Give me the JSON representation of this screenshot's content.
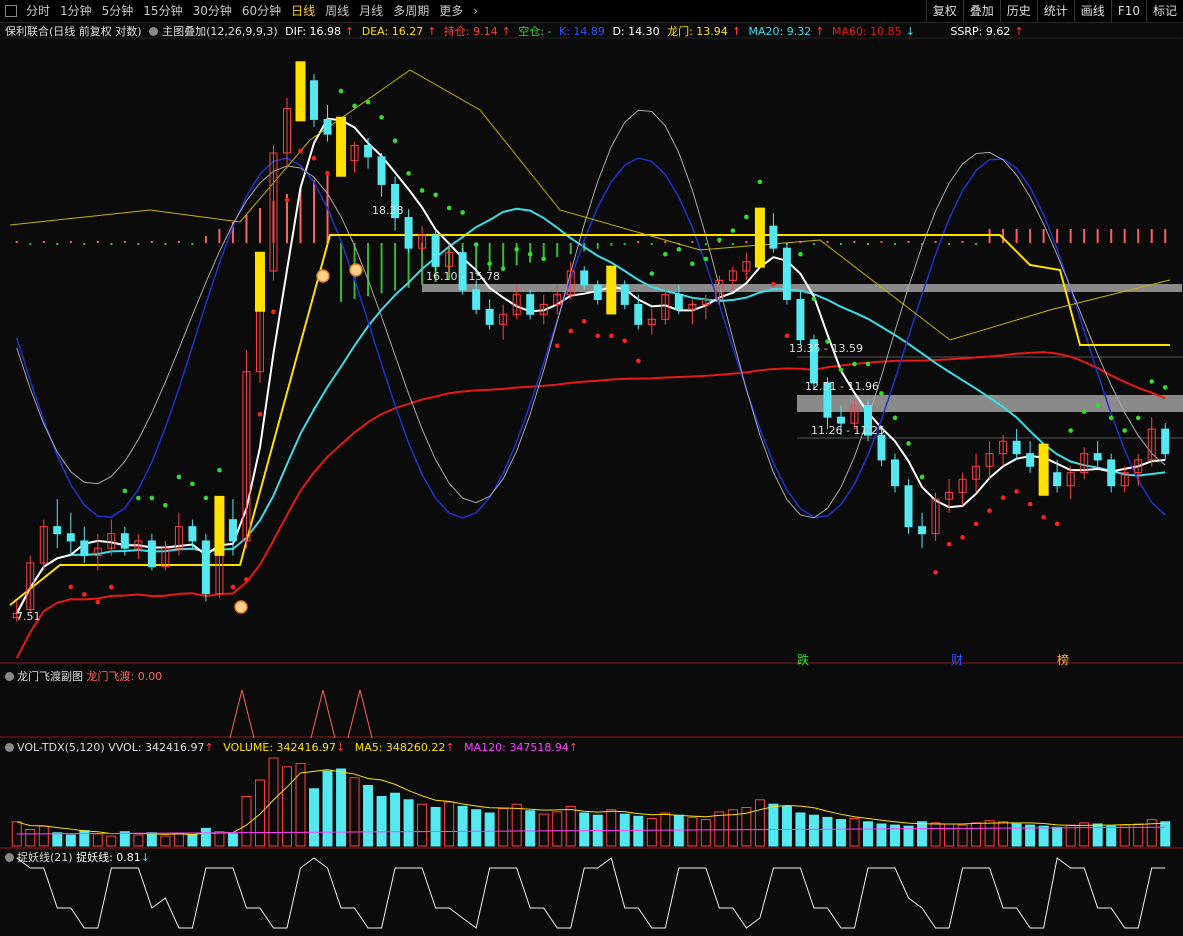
{
  "toolbar": {
    "periods": [
      "分时",
      "1分钟",
      "5分钟",
      "15分钟",
      "30分钟",
      "60分钟",
      "日线",
      "周线",
      "月线",
      "多周期",
      "更多"
    ],
    "active_index": 6,
    "buttons": [
      "复权",
      "叠加",
      "历史",
      "统计",
      "画线",
      "F10",
      "标记"
    ]
  },
  "main_legend": {
    "stock": "保利联合(日线 前复权 对数)",
    "overlay": "主图叠加(12,26,9,9,3)",
    "dif": "DIF: 16.98",
    "dea": "DEA: 16.27",
    "hold": "持仓: 9.14",
    "empty": "空仓: -",
    "k": "K: 14.89",
    "d": "D: 14.30",
    "dragon": "龙门: 13.94",
    "ma20": "MA20: 9.32",
    "ma60": "MA60: 10.85",
    "ssrp": "SSRP: 9.62"
  },
  "annotations": {
    "high": "18.28",
    "zone1": "16.10 - 15.78",
    "zone2": "13.35 - 13.59",
    "zone3": "12.51 - 11.96",
    "zone4": "11.26 - 11.25",
    "low": "7.51",
    "marker_die": "跌",
    "marker_cai": "财",
    "marker_bang": "榜"
  },
  "sub1": {
    "title": "龙门飞渡副图",
    "value": "龙门飞渡: 0.00"
  },
  "sub2": {
    "title": "VOL-TDX(5,120)",
    "vvol": "VVOL: 342416.97",
    "volume": "VOLUME: 342416.97",
    "ma5": "MA5: 348260.22",
    "ma120": "MA120: 347518.94"
  },
  "sub3": {
    "title": "捉妖线(21)",
    "value": "捉妖线: 0.81"
  },
  "colors": {
    "up": "#ff4040",
    "down": "#54e8f0",
    "ma20": "#3fdce8",
    "ma60": "#e81818",
    "price": "#ffffff",
    "yellow": "#ffe000",
    "green": "#33dd33"
  },
  "chart_data": {
    "type": "candlestick",
    "y_scale": "log",
    "candles": [
      [
        7.5,
        7.7,
        7.45,
        7.55
      ],
      [
        7.6,
        8.3,
        7.55,
        8.2
      ],
      [
        8.2,
        8.8,
        8.1,
        8.7
      ],
      [
        8.7,
        9.1,
        8.4,
        8.6
      ],
      [
        8.6,
        8.9,
        8.3,
        8.5
      ],
      [
        8.5,
        8.7,
        8.2,
        8.3
      ],
      [
        8.3,
        8.6,
        8.1,
        8.4
      ],
      [
        8.4,
        8.8,
        8.3,
        8.6
      ],
      [
        8.6,
        8.7,
        8.3,
        8.4
      ],
      [
        8.4,
        8.6,
        8.25,
        8.5
      ],
      [
        8.5,
        8.6,
        8.1,
        8.15
      ],
      [
        8.15,
        8.5,
        8.1,
        8.4
      ],
      [
        8.4,
        8.9,
        8.3,
        8.7
      ],
      [
        8.7,
        8.8,
        8.4,
        8.5
      ],
      [
        8.5,
        8.6,
        7.7,
        7.8
      ],
      [
        7.8,
        9.0,
        7.75,
        8.8
      ],
      [
        8.8,
        9.1,
        8.3,
        8.5
      ],
      [
        8.5,
        11.6,
        8.4,
        11.2
      ],
      [
        11.2,
        13.4,
        11.0,
        13.2
      ],
      [
        13.2,
        16.2,
        13.0,
        16.0
      ],
      [
        16.0,
        17.5,
        15.6,
        17.2
      ],
      [
        17.2,
        18.28,
        16.9,
        18.0
      ],
      [
        18.0,
        18.2,
        16.7,
        16.9
      ],
      [
        16.9,
        17.3,
        16.3,
        16.5
      ],
      [
        16.5,
        16.7,
        15.5,
        15.8
      ],
      [
        15.8,
        16.3,
        15.5,
        16.2
      ],
      [
        16.2,
        16.4,
        15.6,
        15.9
      ],
      [
        15.9,
        16.0,
        14.9,
        15.2
      ],
      [
        15.2,
        15.4,
        14.1,
        14.4
      ],
      [
        14.4,
        14.6,
        13.6,
        13.7
      ],
      [
        13.7,
        14.2,
        13.6,
        14.0
      ],
      [
        14.0,
        14.1,
        13.2,
        13.3
      ],
      [
        13.3,
        13.8,
        13.1,
        13.6
      ],
      [
        13.6,
        13.7,
        12.7,
        12.8
      ],
      [
        12.8,
        13.0,
        12.3,
        12.4
      ],
      [
        12.4,
        12.6,
        12.0,
        12.1
      ],
      [
        12.1,
        12.5,
        11.8,
        12.3
      ],
      [
        12.3,
        12.9,
        12.2,
        12.7
      ],
      [
        12.7,
        12.8,
        12.2,
        12.3
      ],
      [
        12.3,
        12.7,
        12.1,
        12.5
      ],
      [
        12.5,
        12.9,
        12.3,
        12.7
      ],
      [
        12.7,
        13.4,
        12.6,
        13.2
      ],
      [
        13.2,
        13.3,
        12.8,
        12.9
      ],
      [
        12.9,
        13.0,
        12.5,
        12.6
      ],
      [
        12.6,
        13.1,
        12.5,
        12.9
      ],
      [
        12.9,
        13.0,
        12.4,
        12.5
      ],
      [
        12.5,
        12.7,
        12.0,
        12.1
      ],
      [
        12.1,
        12.4,
        11.9,
        12.2
      ],
      [
        12.2,
        12.8,
        12.1,
        12.7
      ],
      [
        12.7,
        12.9,
        12.3,
        12.4
      ],
      [
        12.4,
        12.6,
        12.1,
        12.5
      ],
      [
        12.5,
        12.7,
        12.2,
        12.6
      ],
      [
        12.6,
        13.1,
        12.5,
        13.0
      ],
      [
        13.0,
        13.3,
        12.8,
        13.2
      ],
      [
        13.2,
        13.6,
        13.0,
        13.4
      ],
      [
        13.4,
        14.4,
        13.3,
        14.2
      ],
      [
        14.2,
        14.5,
        13.6,
        13.7
      ],
      [
        13.7,
        13.8,
        12.5,
        12.6
      ],
      [
        12.6,
        12.8,
        11.7,
        11.8
      ],
      [
        11.8,
        11.9,
        10.9,
        11.0
      ],
      [
        11.0,
        11.1,
        10.2,
        10.4
      ],
      [
        10.4,
        10.6,
        10.1,
        10.3
      ],
      [
        10.3,
        10.7,
        10.2,
        10.6
      ],
      [
        10.6,
        10.7,
        10.0,
        10.1
      ],
      [
        10.1,
        10.2,
        9.6,
        9.7
      ],
      [
        9.7,
        9.8,
        9.2,
        9.3
      ],
      [
        9.3,
        9.4,
        8.6,
        8.7
      ],
      [
        8.7,
        8.9,
        8.4,
        8.6
      ],
      [
        8.6,
        9.2,
        8.5,
        9.1
      ],
      [
        9.1,
        9.4,
        8.9,
        9.2
      ],
      [
        9.2,
        9.5,
        9.0,
        9.4
      ],
      [
        9.4,
        9.8,
        9.2,
        9.6
      ],
      [
        9.6,
        10.0,
        9.4,
        9.8
      ],
      [
        9.8,
        10.1,
        9.6,
        10.0
      ],
      [
        10.0,
        10.2,
        9.7,
        9.8
      ],
      [
        9.8,
        10.0,
        9.5,
        9.6
      ],
      [
        9.6,
        9.8,
        9.3,
        9.5
      ],
      [
        9.5,
        9.7,
        9.2,
        9.3
      ],
      [
        9.3,
        9.6,
        9.1,
        9.5
      ],
      [
        9.5,
        9.9,
        9.4,
        9.8
      ],
      [
        9.8,
        10.0,
        9.6,
        9.7
      ],
      [
        9.7,
        9.8,
        9.2,
        9.3
      ],
      [
        9.3,
        9.6,
        9.2,
        9.5
      ],
      [
        9.5,
        9.8,
        9.3,
        9.7
      ],
      [
        9.7,
        10.4,
        9.6,
        10.2
      ],
      [
        10.2,
        10.3,
        9.7,
        9.8
      ]
    ],
    "volume": [
      22,
      15,
      18,
      12,
      10,
      14,
      11,
      9,
      13,
      10,
      12,
      9,
      11,
      10,
      16,
      13,
      11,
      45,
      60,
      80,
      72,
      75,
      52,
      68,
      70,
      62,
      55,
      45,
      48,
      42,
      38,
      35,
      40,
      36,
      33,
      30,
      34,
      38,
      32,
      29,
      31,
      36,
      30,
      28,
      33,
      29,
      27,
      25,
      30,
      28,
      26,
      24,
      31,
      33,
      35,
      42,
      38,
      36,
      30,
      28,
      26,
      24,
      25,
      22,
      20,
      19,
      18,
      22,
      21,
      20,
      19,
      21,
      23,
      22,
      20,
      19,
      18,
      17,
      19,
      21,
      20,
      18,
      19,
      20,
      24,
      22
    ]
  }
}
